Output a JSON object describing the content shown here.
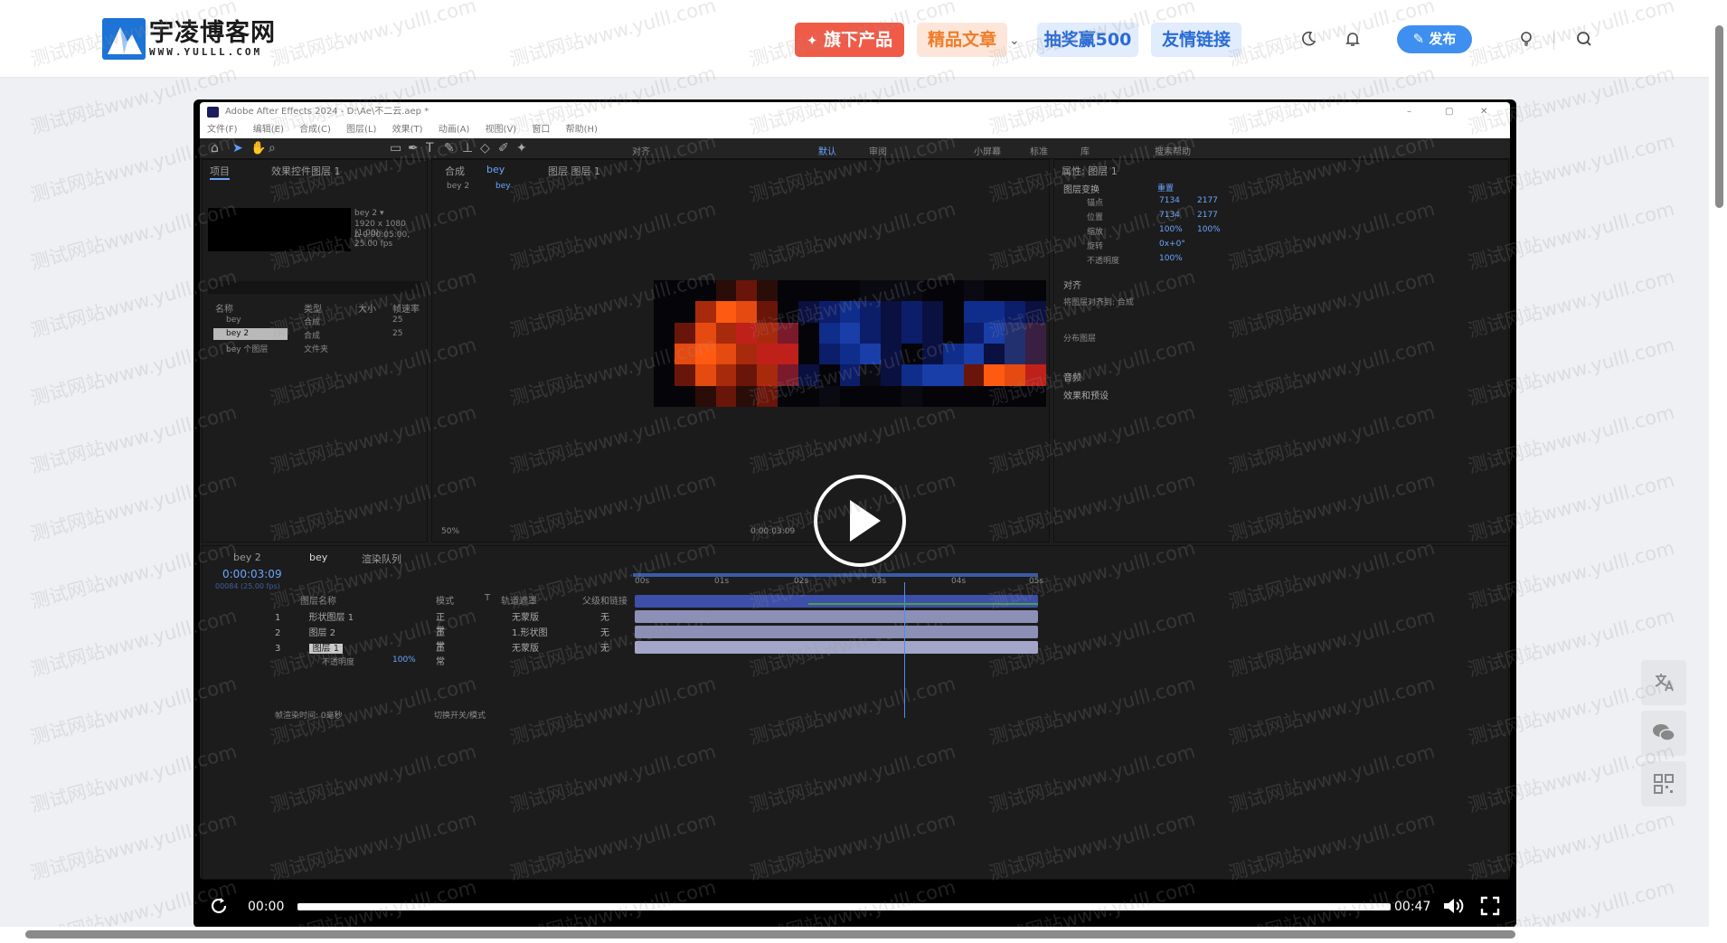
{
  "header": {
    "logo_title": "宇凌博客网",
    "logo_sub": "WWW.YULLL.COM",
    "nav": [
      {
        "label": "旗下产品"
      },
      {
        "label": "精品文章"
      },
      {
        "label": "抽奖赢500"
      },
      {
        "label": "友情链接"
      }
    ],
    "publish_label": "发布",
    "icons": [
      "moon-icon",
      "bell-icon",
      "publish-pencil-icon",
      "lightbulb-icon",
      "search-icon"
    ]
  },
  "watermark_text": "测试网站www.yulll.com",
  "ae": {
    "title": "Adobe After Effects 2024 - D:\\Ae\\不二云.aep *",
    "menu": [
      "文件(F)",
      "编辑(E)",
      "合成(C)",
      "图层(L)",
      "效果(T)",
      "动画(A)",
      "视图(V)",
      "窗口",
      "帮助(H)"
    ],
    "workspace": [
      "默认",
      "审阅",
      "小屏幕",
      "标准",
      "库"
    ],
    "search_help": "搜索帮助",
    "align_label": "对齐",
    "project_tab": "项目",
    "effect_tab": "效果控件图层 1",
    "comp_tab": "合成",
    "comp_name": "bey",
    "layer_tab": "图层 图层 1",
    "breadcrumb": [
      "bey 2",
      "bey"
    ],
    "project_meta": [
      "bey 2 ▾",
      "1920 x 1080 (1.00)",
      "Δ 0:00:05:00, 25.00 fps"
    ],
    "project_columns": [
      "名称",
      "类型",
      "大小",
      "帧速率"
    ],
    "project_items": [
      {
        "name": "bey",
        "type": "合成",
        "fps": "25"
      },
      {
        "name": "bey 2",
        "type": "合成",
        "fps": "25"
      },
      {
        "name": "bey 个图层",
        "type": "文件夹",
        "fps": ""
      }
    ],
    "zoom": "50%",
    "viewer_time": "0:00:03:09",
    "right_panel": {
      "title": "属性: 图层 1",
      "section": "图层变换",
      "reset": "重置",
      "props": [
        {
          "name": "锚点",
          "v1": "7134",
          "v2": "2177"
        },
        {
          "name": "位置",
          "v1": "7134",
          "v2": "2177"
        },
        {
          "name": "缩放",
          "v1": "100%",
          "v2": "100%"
        },
        {
          "name": "旋转",
          "v1": "0x+0°",
          "v2": ""
        },
        {
          "name": "不透明度",
          "v1": "100%",
          "v2": ""
        }
      ],
      "align_title": "对齐",
      "align_to": "将图层对齐到: 合成",
      "distribute": "分布图层",
      "audio": "音频",
      "effects": "效果和预设"
    },
    "timeline": {
      "tabs": [
        "bey 2",
        "bey",
        "渲染队列"
      ],
      "timecode": "0:00:03:09",
      "frames": "00084 (25.00 fps)",
      "columns": [
        "图层名称",
        "模式",
        "T",
        "轨道遮罩",
        "父级和链接"
      ],
      "layers": [
        {
          "num": "1",
          "name": "形状图层 1",
          "mode": "正常",
          "matte": "无蒙版",
          "parent": "无"
        },
        {
          "num": "2",
          "name": "图层 2",
          "mode": "正常",
          "matte": "1.形状图",
          "parent": "无"
        },
        {
          "num": "3",
          "name": "图层 1",
          "mode": "正常",
          "matte": "无蒙版",
          "parent": "无"
        }
      ],
      "sub_prop": "不透明度",
      "sub_value": "100%",
      "ruler": [
        "00s",
        "01s",
        "02s",
        "03s",
        "04s",
        "05s"
      ],
      "render_time": "帧渲染时间: 0毫秒",
      "switch_mode": "切换开关/模式"
    }
  },
  "player": {
    "current": "00:00",
    "duration": "00:47",
    "progress": 0.0,
    "icons": [
      "replay-icon",
      "volume-icon",
      "fullscreen-icon",
      "play-icon"
    ]
  },
  "side_tools": [
    "translate-icon",
    "wechat-icon",
    "qrcode-icon"
  ],
  "colors": {
    "brand_blue": "#1e73d6",
    "accent_red": "#f05b47",
    "accent_orange": "#f07c28",
    "link_blue": "#2a6cd6",
    "publish_blue": "#3e8ff0"
  }
}
